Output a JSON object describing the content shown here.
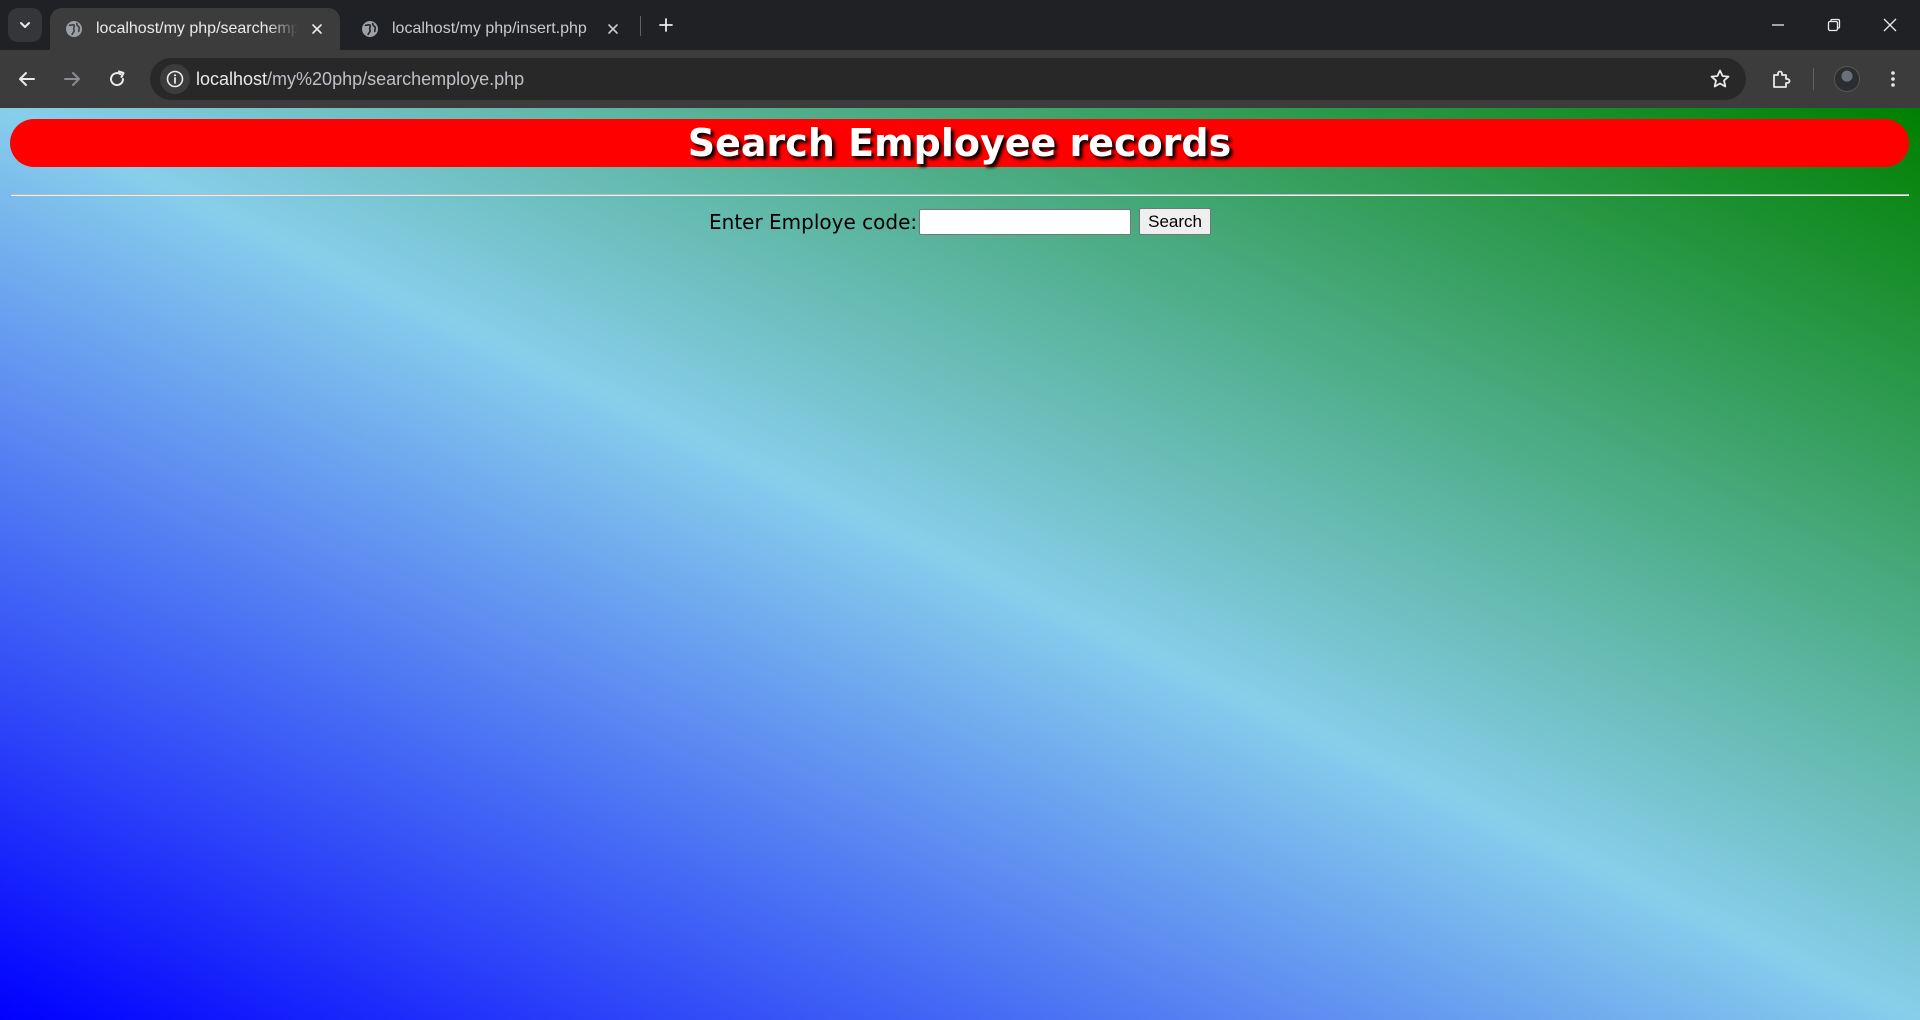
{
  "browser": {
    "tabs": [
      {
        "title": "localhost/my php/searchemploye.php",
        "active": true
      },
      {
        "title": "localhost/my php/insert.php",
        "active": false
      }
    ],
    "address_bar": {
      "host": "localhost",
      "path": "/my%20php/searchemploye.php"
    },
    "icons": {
      "tab_search": "chevron-down-icon",
      "favicon": "globe-icon",
      "tab_close": "close-icon",
      "new_tab": "plus-icon",
      "minimize": "minimize-icon",
      "restore": "restore-icon",
      "close_window": "close-icon",
      "back": "arrow-left-icon",
      "forward": "arrow-right-icon",
      "reload": "reload-icon",
      "site_info": "info-icon",
      "bookmark": "star-icon",
      "extensions": "puzzle-icon",
      "profile": "avatar"
    }
  },
  "page": {
    "heading": "Search Employee records",
    "form": {
      "label": "Enter Employe code:",
      "input_value": "",
      "button_label": "Search"
    },
    "colors": {
      "heading_background": "#ff0000",
      "heading_text": "#ffffff",
      "gradient": [
        "#0000ff",
        "#87ceeb",
        "#008000"
      ]
    }
  }
}
